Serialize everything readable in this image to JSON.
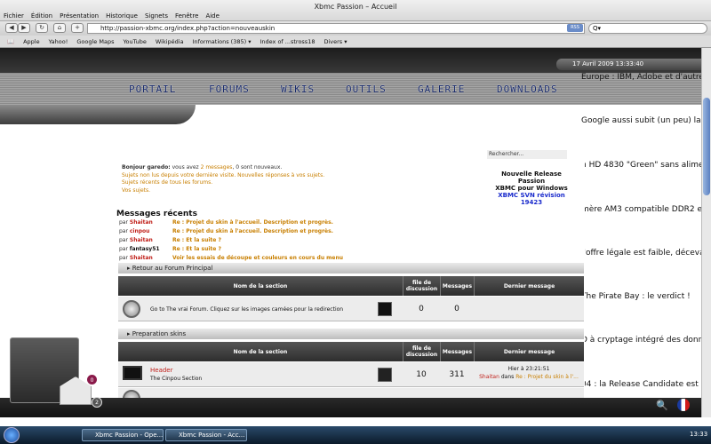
{
  "window": {
    "title": "Xbmc Passion – Accueil"
  },
  "menubar": [
    "Fichier",
    "Édition",
    "Présentation",
    "Historique",
    "Signets",
    "Fenêtre",
    "Aide"
  ],
  "url": "http://passion-xbmc.org/index.php?action=nouveauskin",
  "rss": "RSS",
  "search_placeholder": "Q▾",
  "bookmarks": [
    "Apple",
    "Yahoo!",
    "Google Maps",
    "YouTube",
    "Wikipédia",
    "Informations (385) ▾",
    "Index of ...stross18",
    "Divers ▾"
  ],
  "date": "17 Avril 2009 13:33:40",
  "nav": [
    "PORTAIL",
    "FORUMS",
    "WIKIS",
    "OUTILS",
    "GALERIE",
    "DOWNLOADS"
  ],
  "news": [
    "Europe : IBM, Adobe et d'autres en",
    "Google aussi subit (un peu) la crise",
    "n HD 4830 \"Green\" sans alimentation",
    "mère AM3 compatible DDR2 et DDR",
    "l'offre légale est faible, décevant",
    "The Pirate Bay : le verdict !",
    "D à cryptage intégré des données",
    "04 : la Release Candidate est dispo"
  ],
  "search_label": "Rechercher...",
  "release": {
    "line1": "Nouvelle Release Passion",
    "line2": "XBMC pour Windows",
    "line3": "XBMC SVN révision 19423"
  },
  "welcome": {
    "greeting": "Bonjour garedo:",
    "msg_pre": " vous avez ",
    "messages_link": "2 messages",
    "msg_post": ", 0 sont nouveaux.",
    "l2": "Sujets non lus depuis votre dernière visite. Nouvelles réponses à vos sujets.",
    "l3": "Sujets récents de tous les forums.",
    "l4": "Vos sujets."
  },
  "recent_title": "Messages récents",
  "recent": [
    {
      "by": "Shaitan",
      "title": "Re : Projet du skin à l'accueil. Description et progrès."
    },
    {
      "by": "cinpou",
      "title": "Re : Projet du skin à l'accueil. Description et progrès."
    },
    {
      "by": "Shaitan",
      "title": "Re : Et la suite ?"
    },
    {
      "by": "fantasy51",
      "title": "Re : Et la suite ?"
    },
    {
      "by": "Shaitan",
      "title": "Voir les essais de découpe et couleurs en cours du menu"
    }
  ],
  "par": "par",
  "section1": {
    "title": "Retour au Forum Principal",
    "headers": {
      "name": "Nom de la section",
      "files": "file de discussion",
      "messages": "Messages",
      "last": "Dernier message"
    },
    "row": {
      "label": "Go to The vrai Forum. Cliquez sur les images camées pour la redirection",
      "files": "0",
      "messages": "0"
    }
  },
  "section2": {
    "title": "Preparation skins",
    "row": {
      "name": "Header",
      "sub": "The Cinpou Section",
      "files": "10",
      "messages": "311",
      "last_time": "Hier à 23:21:51",
      "last_by": "Shaitan",
      "last_in": "dans",
      "last_title": "Re : Projet du skin à l'..."
    }
  },
  "badges": {
    "mail": "0",
    "count": "2"
  },
  "taskbar": {
    "task1": "Xbmc Passion - Ope...",
    "task2": "Xbmc Passion - Acc...",
    "clock": "13:33"
  }
}
